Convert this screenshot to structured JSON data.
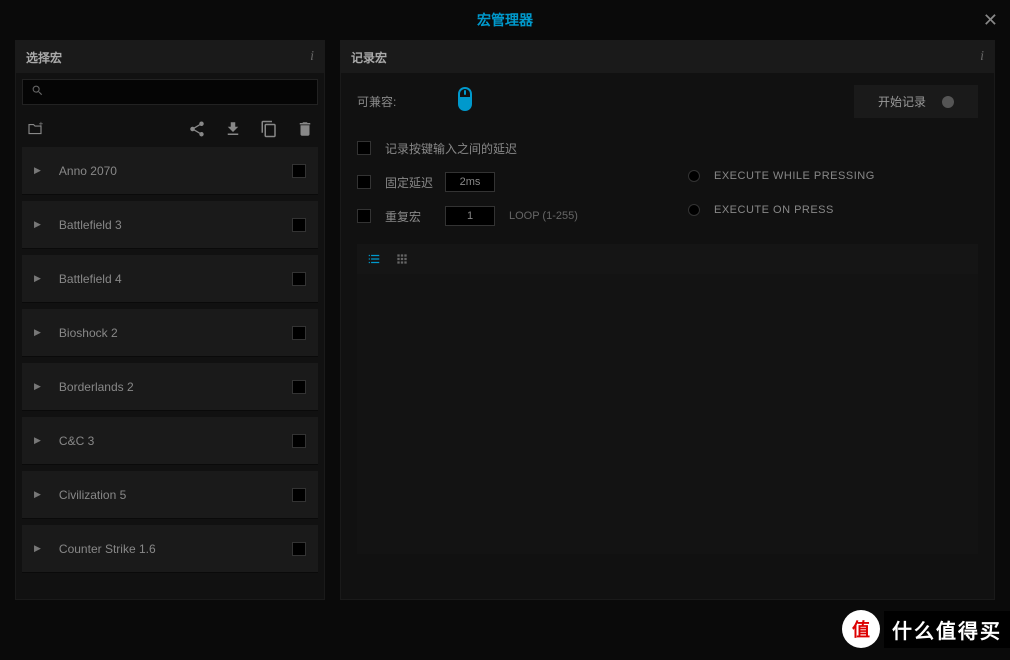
{
  "title": "宏管理器",
  "left": {
    "header": "选择宏",
    "search_placeholder": "",
    "items": [
      {
        "name": "Anno 2070"
      },
      {
        "name": "Battlefield 3"
      },
      {
        "name": "Battlefield 4"
      },
      {
        "name": "Bioshock 2"
      },
      {
        "name": "Borderlands 2"
      },
      {
        "name": "C&C 3"
      },
      {
        "name": "Civilization 5"
      },
      {
        "name": "Counter Strike 1.6"
      }
    ]
  },
  "right": {
    "header": "记录宏",
    "compat_label": "可兼容:",
    "record_button": "开始记录",
    "options": {
      "delay_between": "记录按键输入之间的延迟",
      "fixed_delay": "固定延迟",
      "fixed_delay_value": "2ms",
      "repeat": "重复宏",
      "repeat_value": "1",
      "loop_hint": "LOOP (1-255)"
    },
    "radios": {
      "while_pressing": "EXECUTE WHILE PRESSING",
      "on_press": "EXECUTE ON PRESS"
    }
  },
  "brand": {
    "circle": "值",
    "text": "什么值得买"
  }
}
